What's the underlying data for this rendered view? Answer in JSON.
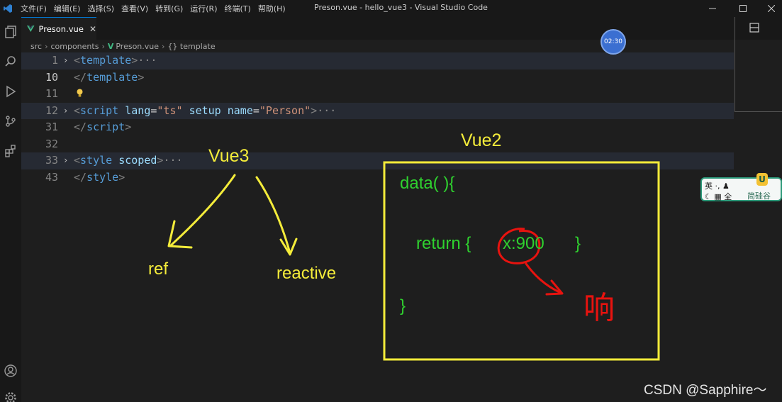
{
  "app": {
    "window_title": "Preson.vue - hello_vue3 - Visual Studio Code",
    "menu": [
      "文件(F)",
      "编辑(E)",
      "选择(S)",
      "查看(V)",
      "转到(G)",
      "运行(R)",
      "终端(T)",
      "帮助(H)"
    ]
  },
  "tab": {
    "label": "Preson.vue",
    "close_glyph": "✕"
  },
  "breadcrumb": [
    "src",
    "components",
    "Preson.vue",
    "{} template"
  ],
  "lines": [
    {
      "num": "1",
      "current": false,
      "highlight": true,
      "fold": "›",
      "parts": [
        [
          "tag",
          "<"
        ],
        [
          "tname",
          "template"
        ],
        [
          "tag",
          ">"
        ],
        [
          "dots",
          "···"
        ]
      ]
    },
    {
      "num": "10",
      "current": true,
      "highlight": false,
      "fold": "",
      "parts": [
        [
          "tag",
          "</"
        ],
        [
          "tname",
          "template"
        ],
        [
          "tag",
          ">"
        ]
      ]
    },
    {
      "num": "11",
      "current": false,
      "highlight": false,
      "fold": "",
      "parts": []
    },
    {
      "num": "12",
      "current": false,
      "highlight": true,
      "fold": "›",
      "parts": [
        [
          "tag",
          "<"
        ],
        [
          "tname",
          "script"
        ],
        [
          "plain",
          " "
        ],
        [
          "attr",
          "lang"
        ],
        [
          "plain",
          "="
        ],
        [
          "str",
          "\"ts\""
        ],
        [
          "plain",
          " "
        ],
        [
          "attr",
          "setup"
        ],
        [
          "plain",
          " "
        ],
        [
          "attr",
          "name"
        ],
        [
          "plain",
          "="
        ],
        [
          "str",
          "\"Person\""
        ],
        [
          "tag",
          ">"
        ],
        [
          "dots",
          "···"
        ]
      ]
    },
    {
      "num": "31",
      "current": false,
      "highlight": false,
      "fold": "",
      "parts": [
        [
          "tag",
          "</"
        ],
        [
          "tname",
          "script"
        ],
        [
          "tag",
          ">"
        ]
      ]
    },
    {
      "num": "32",
      "current": false,
      "highlight": false,
      "fold": "",
      "parts": []
    },
    {
      "num": "33",
      "current": false,
      "highlight": true,
      "fold": "›",
      "parts": [
        [
          "tag",
          "<"
        ],
        [
          "tname",
          "style"
        ],
        [
          "plain",
          " "
        ],
        [
          "attr",
          "scoped"
        ],
        [
          "tag",
          ">"
        ],
        [
          "dots",
          "···"
        ]
      ]
    },
    {
      "num": "43",
      "current": false,
      "highlight": false,
      "fold": "",
      "parts": [
        [
          "tag",
          "</"
        ],
        [
          "tname",
          "style"
        ],
        [
          "tag",
          ">"
        ]
      ]
    }
  ],
  "timer": "02:30",
  "ime": {
    "line1": "英 ·, ♟",
    "line2": "☾ ▦ 全",
    "brand": "简硅谷",
    "badge": "U"
  },
  "annotations": {
    "vue3": "Vue3",
    "vue2": "Vue2",
    "ref": "ref",
    "reactive": "reactive",
    "data_line1": "data( ){",
    "data_return": "return {",
    "data_value": "x:900",
    "data_close_inner": "}",
    "data_close": "}",
    "red_text": "响"
  },
  "watermark": "CSDN @Sapphire～",
  "colors": {
    "accent": "#0078d4",
    "annot_yellow": "#f4ec3a",
    "annot_green": "#2fd12f",
    "annot_red": "#e8130f"
  }
}
